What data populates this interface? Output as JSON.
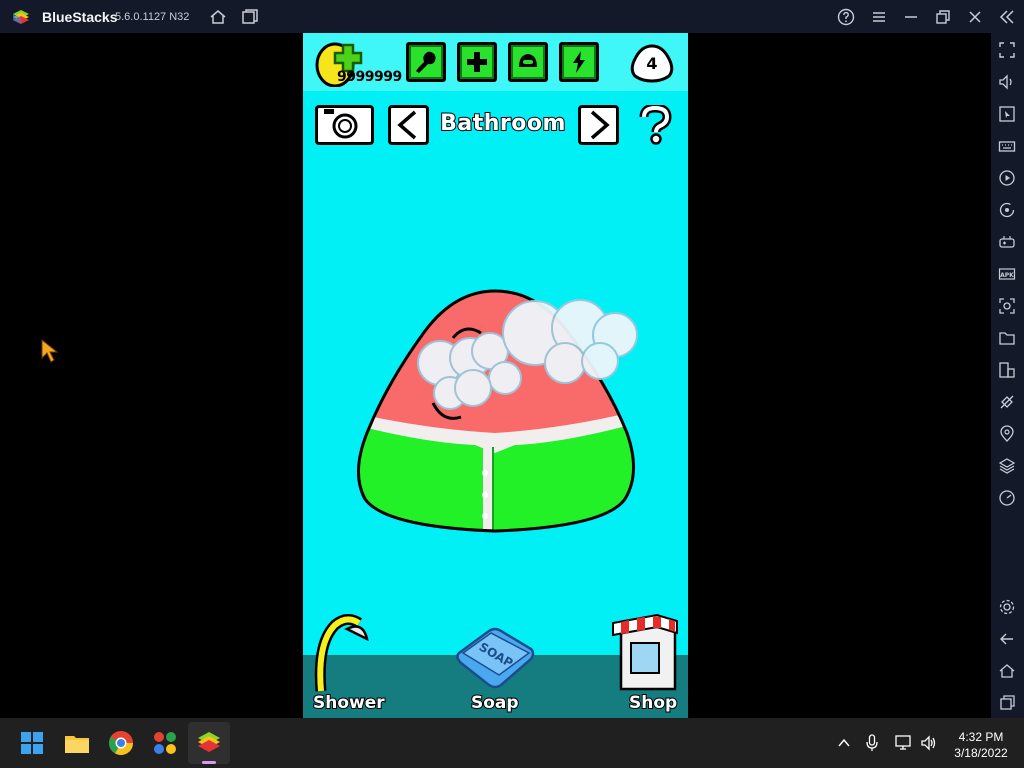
{
  "window": {
    "app_name": "BlueStacks",
    "version": "5.6.0.1127 N32"
  },
  "game": {
    "coins": "9999999",
    "level": "4",
    "room_title": "Bathroom",
    "labels": {
      "shower": "Shower",
      "soap": "Soap",
      "shop": "Shop"
    },
    "soap_text": "SOAP"
  },
  "taskbar": {
    "time": "4:32 PM",
    "date": "3/18/2022"
  },
  "colors": {
    "background": "#00f0f6",
    "pou_body_top": "#f96b6a",
    "pou_body_bottom": "#22f128"
  }
}
